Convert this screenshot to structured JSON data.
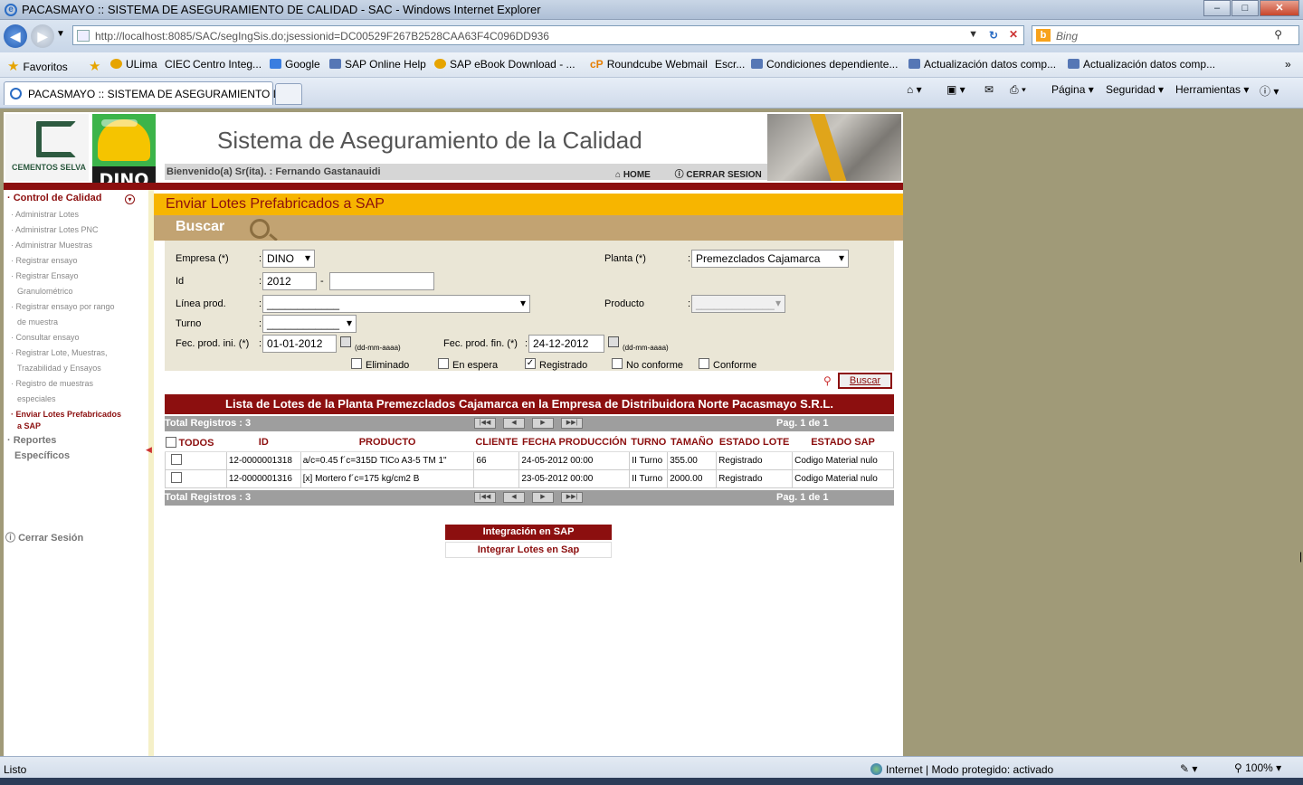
{
  "window": {
    "title": "PACASMAYO :: SISTEMA DE ASEGURAMIENTO DE CALIDAD - SAC - Windows Internet Explorer",
    "min": "–",
    "max": "□",
    "close": "✕"
  },
  "address": {
    "url": "http://localhost:8085/SAC/segIngSis.do;jsessionid=DC00529F267B2528CAA63F4C096DD936",
    "search_placeholder": "Bing"
  },
  "favorites": {
    "label": "Favoritos",
    "items": [
      "ULima",
      "CIEC",
      "Centro Integ...",
      "Google",
      "SAP Online Help",
      "SAP eBook Download - ...",
      "Roundcube Webmail",
      "Escr...",
      "Condiciones dependiente...",
      "Actualización datos comp...",
      "Actualización datos comp..."
    ]
  },
  "tab": {
    "title": "PACASMAYO :: SISTEMA DE ASEGURAMIENTO D..."
  },
  "commands": {
    "page": "Página",
    "security": "Seguridad",
    "tools": "Herramientas"
  },
  "header": {
    "title": "Sistema de Aseguramiento de la Calidad",
    "welcome": "Bienvenido(a) Sr(ita). : Fernando Gastanauidi",
    "home": "HOME",
    "logout": "CERRAR SESION",
    "logo1_text": "CEMENTOS SELVA",
    "logo2_text": "DINO"
  },
  "sidebar": {
    "section1": "Control de Calidad",
    "items": [
      "Administrar Lotes",
      "Administrar Lotes PNC",
      "Administrar Muestras",
      "Registrar ensayo",
      "Registrar Ensayo",
      "Granulométrico",
      "Registrar ensayo por rango",
      "de muestra",
      "Consultar ensayo",
      "Registrar Lote, Muestras,",
      "Trazabilidad y Ensayos",
      "Registro de muestras",
      "especiales",
      "Enviar Lotes Prefabricados",
      "a SAP"
    ],
    "section2": "Reportes",
    "section3": "Específicos",
    "logout": "Cerrar Sesión"
  },
  "page": {
    "title": "Enviar Lotes Prefabricados a SAP",
    "search_header": "Buscar"
  },
  "form": {
    "empresa_label": "Empresa (*)",
    "empresa": "DINO",
    "planta_label": "Planta (*)",
    "planta": "Premezclados Cajamarca",
    "id_label": "Id",
    "id_year": "2012",
    "id_sep": "-",
    "id_num": "",
    "linea_label": "Línea prod.",
    "linea": "____________",
    "producto_label": "Producto",
    "producto": "_____________",
    "turno_label": "Turno",
    "turno": "____________",
    "fini_label": "Fec. prod. ini. (*)",
    "fini": "01-01-2012",
    "ffin_label": "Fec. prod. fin. (*)",
    "ffin": "24-12-2012",
    "date_hint": "(dd-mm-aaaa)",
    "colon": ":",
    "states": [
      {
        "label": "Eliminado",
        "checked": false
      },
      {
        "label": "En espera",
        "checked": false
      },
      {
        "label": "Registrado",
        "checked": true
      },
      {
        "label": "No conforme",
        "checked": false
      },
      {
        "label": "Conforme",
        "checked": false
      }
    ],
    "search_button": "Buscar"
  },
  "results": {
    "title": "Lista de Lotes de la Planta Premezclados Cajamarca en la Empresa de Distribuidora Norte Pacasmayo S.R.L.",
    "total": "Total Registros : 3",
    "page": "Pag. 1 de 1",
    "columns": [
      "TODOS",
      "ID",
      "PRODUCTO",
      "CLIENTE",
      "FECHA PRODUCCIÓN",
      "TURNO",
      "TAMAÑO",
      "ESTADO LOTE",
      "ESTADO SAP"
    ],
    "rows": [
      {
        "id": "12-0000001318",
        "producto": "a/c=0.45 f´c=315D TICo A3-5 TM 1\"",
        "cliente": "66",
        "fecha": "24-05-2012 00:00",
        "turno": "II Turno",
        "tamano": "355.00",
        "estado": "Registrado",
        "sap": "Codigo Material nulo"
      },
      {
        "id": "12-0000001316",
        "producto": "[x] Mortero f´c=175 kg/cm2 B",
        "cliente": "",
        "fecha": "23-05-2012 00:00",
        "turno": "II Turno",
        "tamano": "2000.00",
        "estado": "Registrado",
        "sap": "Codigo Material nulo"
      }
    ]
  },
  "sap": {
    "header": "Integración en SAP",
    "link": "Integrar Lotes en Sap"
  },
  "status": {
    "left": "Listo",
    "zone": "Internet | Modo protegido: activado",
    "zoom": "100%"
  }
}
